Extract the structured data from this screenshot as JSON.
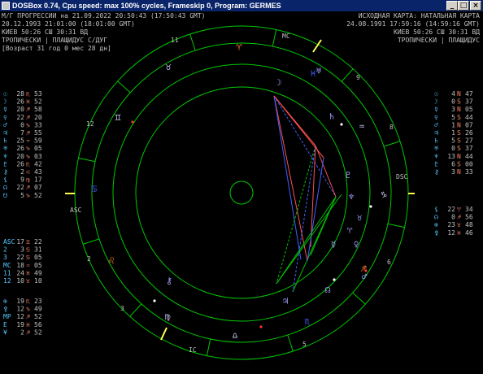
{
  "window": {
    "title": "DOSBox 0.74, Cpu speed: max 100% cycles, Frameskip  0, Program:  GERMES",
    "minimize_glyph": "_",
    "maximize_glyph": "□",
    "close_glyph": "×"
  },
  "header_left": {
    "line1": "М/Г ПРОГРЕССИИ на 21.09.2022 20:50:43 (17:50:43 GMT)",
    "line2": "20.12.1993 21:01:00 (18:01:00 GMT)",
    "line3": "КИЕВ   50:26 СШ   30:31 ВД",
    "line4": "ТРОПИЧЕСКИ | ПЛАЩИДУС С/ДУГ",
    "line5": "[Возраст 31 год 0 мес 28 дн]"
  },
  "header_right": {
    "line1": "ИСХОДНАЯ КАРТА: НАТАЛЬНАЯ КАРТА",
    "line2": "24.08.1991 17:59:16 (14:59:16 GMT)",
    "line3": "КИЕВ   50:26 СШ   30:31 ВД",
    "line4": "ТРОПИЧЕСКИ | ПЛАЩИДУС"
  },
  "left_table": [
    {
      "p": "☉",
      "d": "28",
      "s": "♏",
      "m": "53"
    },
    {
      "p": "☽",
      "d": "26",
      "s": "♓",
      "m": "52"
    },
    {
      "p": "☿",
      "d": "20",
      "s": "♐",
      "m": "58"
    },
    {
      "p": "♀",
      "d": "22",
      "s": "♐",
      "m": "20"
    },
    {
      "p": "♂",
      "d": "0",
      "s": "♑",
      "m": "33"
    },
    {
      "p": "♃",
      "d": "7",
      "s": "♐",
      "m": "55"
    },
    {
      "p": "♄",
      "d": "25",
      "s": "♒",
      "m": "59"
    },
    {
      "p": "♅",
      "d": "26",
      "s": "♑",
      "m": "05"
    },
    {
      "p": "♆",
      "d": "20",
      "s": "♑",
      "m": "03"
    },
    {
      "p": "♇",
      "d": "26",
      "s": "♏",
      "m": "42"
    },
    {
      "p": "⚷",
      "d": "2",
      "s": "♌",
      "m": "43"
    },
    {
      "p": "⚸",
      "d": "9",
      "s": "♍",
      "m": "17"
    },
    {
      "p": "☊",
      "d": "22",
      "s": "♐",
      "m": "07"
    },
    {
      "p": "☋",
      "d": "5",
      "s": "♑",
      "m": "52"
    }
  ],
  "left_angles": [
    {
      "p": "ASC",
      "d": "17",
      "s": "♊",
      "m": "22"
    },
    {
      "p": "2",
      "d": "3",
      "s": "♋",
      "m": "31"
    },
    {
      "p": "3",
      "d": "22",
      "s": "♋",
      "m": "05"
    },
    {
      "p": "MC",
      "d": "18",
      "s": "♒",
      "m": "05"
    },
    {
      "p": "11",
      "d": "24",
      "s": "♓",
      "m": "49"
    },
    {
      "p": "12",
      "d": "10",
      "s": "♉",
      "m": "10"
    }
  ],
  "left_extra": [
    {
      "p": "⊕",
      "d": "19",
      "s": "♏",
      "m": "23"
    },
    {
      "p": "⚴",
      "d": "12",
      "s": "♑",
      "m": "49"
    },
    {
      "p": "MP",
      "d": "12",
      "s": "♐",
      "m": "52"
    },
    {
      "p": "E",
      "d": "19",
      "s": "♓",
      "m": "56"
    },
    {
      "p": "¥",
      "d": "2",
      "s": "♐",
      "m": "52"
    }
  ],
  "right_table": [
    {
      "p": "☉",
      "d": "4",
      "s": "N",
      "m": "47"
    },
    {
      "p": "☽",
      "d": "0",
      "s": "S",
      "m": "37"
    },
    {
      "p": "☿",
      "d": "3",
      "s": "N",
      "m": "05"
    },
    {
      "p": "♀",
      "d": "5",
      "s": "S",
      "m": "44"
    },
    {
      "p": "♂",
      "d": "1",
      "s": "N",
      "m": "07"
    },
    {
      "p": "♃",
      "d": "1",
      "s": "S",
      "m": "26"
    },
    {
      "p": "♄",
      "d": "5",
      "s": "S",
      "m": "27"
    },
    {
      "p": "♅",
      "d": "0",
      "s": "S",
      "m": "37"
    },
    {
      "p": "♆",
      "d": "13",
      "s": "N",
      "m": "44"
    },
    {
      "p": "♇",
      "d": "6",
      "s": "S",
      "m": "00"
    },
    {
      "p": "⚷",
      "d": "3",
      "s": "N",
      "m": "33"
    }
  ],
  "right_extra": [
    {
      "p": "⚸",
      "d": "22",
      "s": "♈",
      "m": "34"
    },
    {
      "p": "☊",
      "d": "0",
      "s": "♐",
      "m": "56"
    },
    {
      "p": "⊕",
      "d": "23",
      "s": "♉",
      "m": "48"
    },
    {
      "p": "⚴",
      "d": "12",
      "s": "♓",
      "m": "46"
    }
  ],
  "wheel": {
    "labels": {
      "mc": "MC",
      "ic": "IC",
      "asc": "ASC",
      "dsc": "DSC"
    },
    "house_numbers": [
      "11",
      "9",
      "8",
      "12",
      "2",
      "3",
      "5",
      "6"
    ],
    "outer_signs": [
      "♈",
      "♉",
      "♊",
      "♋",
      "♌",
      "♍",
      "♎",
      "♏",
      "♐",
      "♑",
      "♒",
      "♓"
    ],
    "inner_planets": [
      "☽",
      "♅",
      "♄",
      "♇",
      "♆",
      "☿",
      "♀",
      "♂",
      "♃",
      "☊",
      "⚷",
      "♈",
      "♉"
    ],
    "colors": {
      "ring": "#00c800",
      "mc_axis": "#ffff50",
      "sign_fire": "#ff7f30",
      "sign_air": "#d0d0ff",
      "sign_water": "#4060ff",
      "planet": "#a0a0ff"
    }
  }
}
